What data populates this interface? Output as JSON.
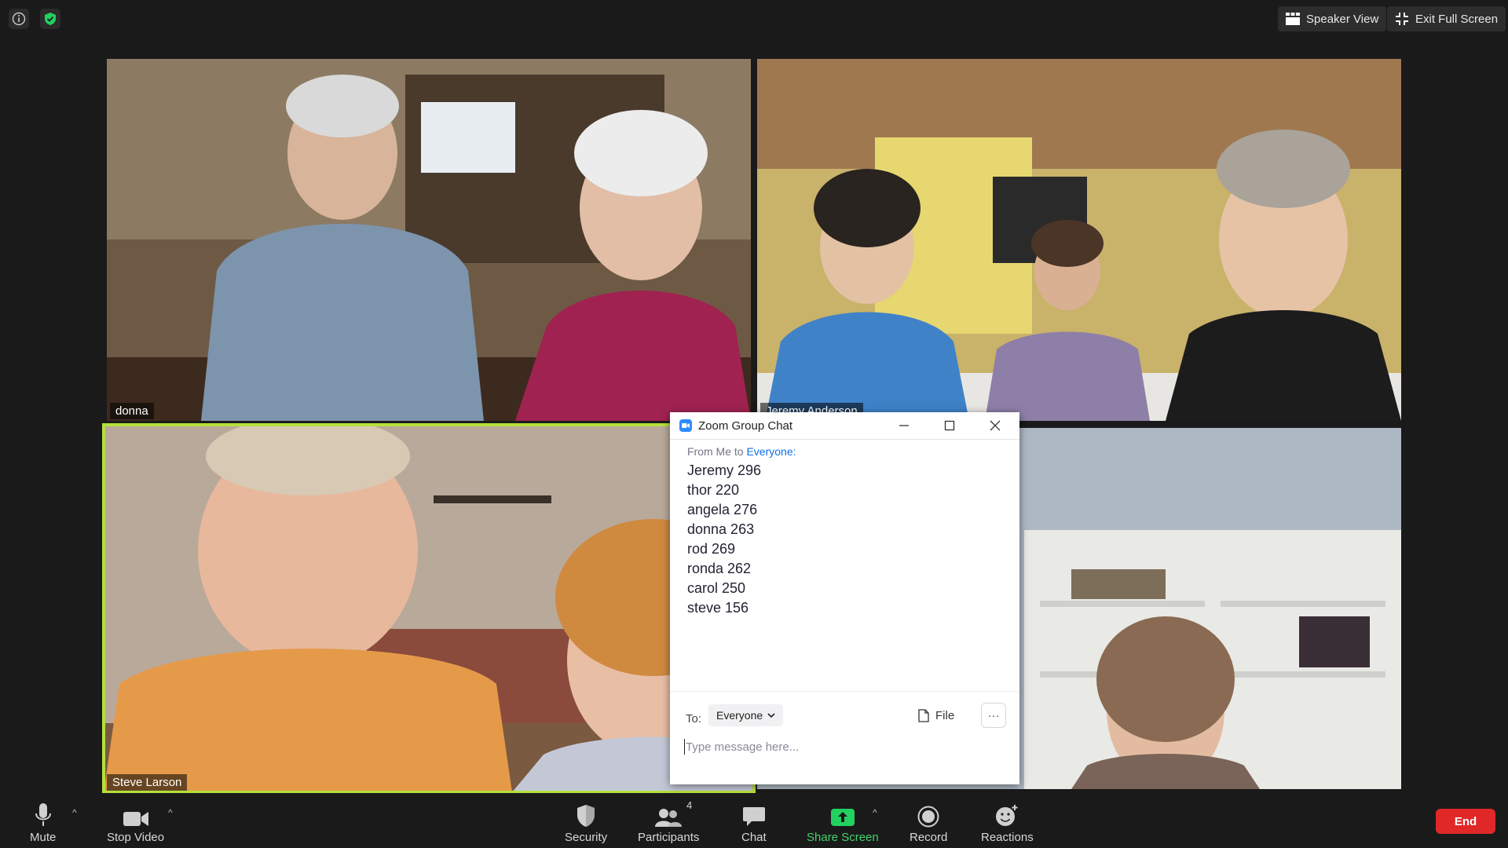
{
  "top_bar": {
    "speaker_view_label": "Speaker View",
    "exit_full_screen_label": "Exit Full Screen"
  },
  "tiles": [
    {
      "name": "donna"
    },
    {
      "name": "Jeremy Anderson"
    },
    {
      "name": "Steve Larson",
      "active": true
    },
    {
      "name": ""
    }
  ],
  "chat": {
    "title": "Zoom Group Chat",
    "from_label": "From Me to",
    "to_target": "Everyone:",
    "messages": [
      "Jeremy 296",
      "thor 220",
      "angela 276",
      "donna 263",
      "rod 269",
      "ronda 262",
      "carol 250",
      "steve 156"
    ],
    "to_label": "To:",
    "to_selected": "Everyone",
    "file_label": "File",
    "more_label": "···",
    "input_placeholder": "Type message here..."
  },
  "toolbar": {
    "mute_label": "Mute",
    "stop_video_label": "Stop Video",
    "security_label": "Security",
    "participants_label": "Participants",
    "participants_count": "4",
    "chat_label": "Chat",
    "share_screen_label": "Share Screen",
    "record_label": "Record",
    "reactions_label": "Reactions",
    "end_label": "End"
  },
  "colors": {
    "accent": "#2d8cff",
    "share_green": "#40d36b",
    "end_red": "#e02828",
    "active_speaker": "#b5e03b"
  }
}
